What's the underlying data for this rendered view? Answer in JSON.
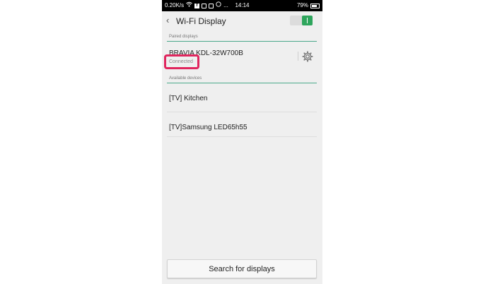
{
  "status_bar": {
    "speed": "0.20K/s",
    "time": "14:14",
    "battery": "79%",
    "battery_level": 0.79
  },
  "header": {
    "title": "Wi-Fi Display",
    "toggle_on": true
  },
  "paired": {
    "section_label": "Paired displays",
    "items": [
      {
        "name": "BRAVIA KDL-32W700B",
        "status": "Connected"
      }
    ]
  },
  "available": {
    "section_label": "Available devices",
    "items": [
      {
        "name": "[TV] Kitchen"
      },
      {
        "name": "[TV]Samsung LED65h55"
      }
    ]
  },
  "search_button_label": "Search for displays",
  "colors": {
    "accent_green": "#2ea55c",
    "divider_teal": "#49a88a",
    "highlight_pink": "#e0265e"
  }
}
